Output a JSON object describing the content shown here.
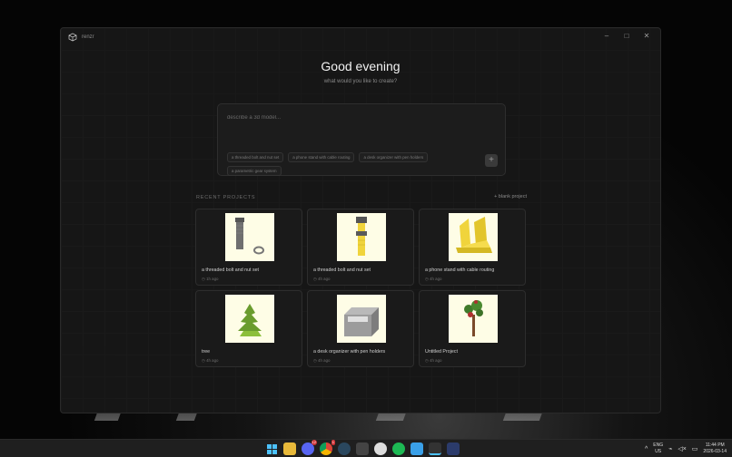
{
  "app": {
    "title": "renzr",
    "controls": {
      "minimize": "–",
      "maximize": "□",
      "close": "✕"
    }
  },
  "hero": {
    "greeting": "Good evening",
    "subtitle": "what would you like to create?"
  },
  "prompt": {
    "placeholder": "describe a 3d model...",
    "value": "",
    "suggestions": [
      "a threaded bolt and nut set",
      "a phone stand with cable routing",
      "a desk organizer with pen holders",
      "a parametric gear system"
    ],
    "submit_icon": "+"
  },
  "recent": {
    "label": "RECENT PROJECTS",
    "blank_button": "+ blank project",
    "projects": [
      {
        "title": "a threaded bolt and nut set",
        "time": "1h ago",
        "thumb": "bolt-nut"
      },
      {
        "title": "a threaded bolt and nut set",
        "time": "4h ago",
        "thumb": "bolt-yellow"
      },
      {
        "title": "a phone stand with cable routing",
        "time": "4h ago",
        "thumb": "phone-stand"
      },
      {
        "title": "tree",
        "time": "4h ago",
        "thumb": "tree-green"
      },
      {
        "title": "a desk organizer with pen holders",
        "time": "4h ago",
        "thumb": "box"
      },
      {
        "title": "Untitled Project",
        "time": "4h ago",
        "thumb": "tree-red"
      }
    ]
  },
  "taskbar": {
    "apps": [
      {
        "name": "windows-start-icon",
        "badge": ""
      },
      {
        "name": "file-explorer-icon",
        "badge": ""
      },
      {
        "name": "discord-icon",
        "badge": "12"
      },
      {
        "name": "chrome-icon",
        "badge": "1"
      },
      {
        "name": "steam-icon",
        "badge": ""
      },
      {
        "name": "game-icon",
        "badge": ""
      },
      {
        "name": "obs-icon",
        "badge": ""
      },
      {
        "name": "spotify-icon",
        "badge": ""
      },
      {
        "name": "notepad-icon",
        "badge": ""
      },
      {
        "name": "renzr-icon",
        "badge": ""
      },
      {
        "name": "app-a-icon",
        "badge": ""
      }
    ],
    "lang_top": "ENG",
    "lang_bottom": "US",
    "time": "11:44 PM",
    "date": "2026-03-14"
  },
  "colors": {
    "window_bg": "#161616",
    "thumb_bg": "#fefde6",
    "accent_yellow": "#f0d43c",
    "taskbar_bg": "#1f1f1f"
  }
}
